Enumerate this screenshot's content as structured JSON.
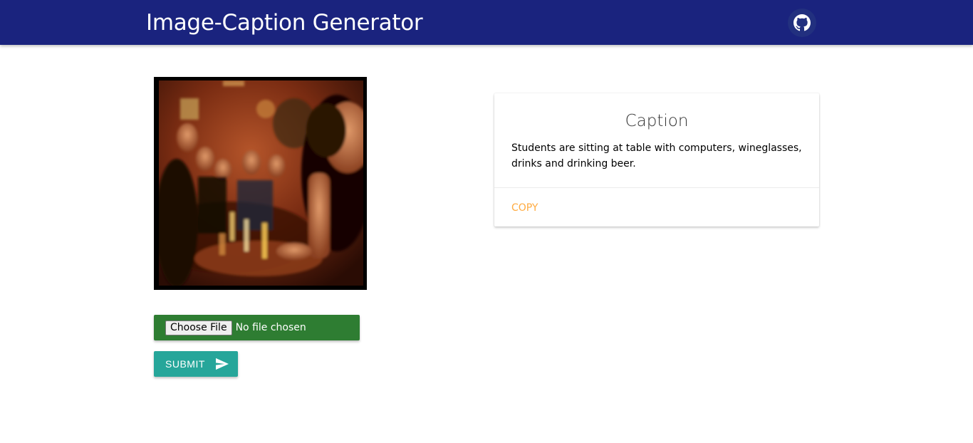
{
  "header": {
    "title": "Image-Caption Generator",
    "github_icon": "github-icon",
    "bg_color": "#1a237e"
  },
  "upload": {
    "choose_file_label": "Choose File",
    "no_file_text": "No file chosen",
    "bg_color": "#2e7d32"
  },
  "submit": {
    "label": "SUBMIT",
    "icon": "send-icon",
    "bg_color": "#26a69a"
  },
  "caption_card": {
    "title": "Caption",
    "text": "Students are sitting at table with computers, wineglasses, drinks and drinking beer.",
    "copy_label": "COPY",
    "copy_color": "#ffab40"
  }
}
